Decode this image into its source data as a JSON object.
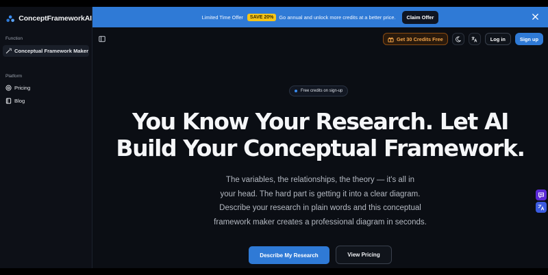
{
  "brand": {
    "name": "ConceptFrameworkAI",
    "logo_icon": "molecule-logo-icon"
  },
  "sidebar": {
    "function_label": "Function",
    "platform_label": "Platform",
    "function_items": [
      {
        "label": "Conceptual Framework Maker",
        "icon": "magic-wand-icon",
        "active": true
      }
    ],
    "platform_items": [
      {
        "label": "Pricing",
        "icon": "coin-icon"
      },
      {
        "label": "Blog",
        "icon": "book-icon"
      }
    ]
  },
  "banner": {
    "text_before": "Limited Time Offer",
    "badge": "SAVE 20%",
    "text_after": "Go annual and unlock more credits at a better price.",
    "cta": "Claim Offer",
    "background": "#2f7ad6",
    "badge_color": "#f5c518"
  },
  "topbar": {
    "credits_button": "Get 30 Credits Free",
    "login": "Log in",
    "signup": "Sign up",
    "icons": [
      "sidebar-toggle-icon",
      "moon-icon",
      "translate-icon"
    ]
  },
  "hero": {
    "pill": "Free credits on sign-up",
    "title_line1": "You Know Your Research. Let AI",
    "title_line2": "Build Your Conceptual Framework.",
    "desc_lines": [
      "The variables, the relationships, the theory — it's all in",
      "your head. The hard part is getting it into a clear diagram.",
      "Describe your research in plain words and this conceptual",
      "framework maker creates a professional diagram in seconds."
    ],
    "primary_cta": "Describe My Research",
    "secondary_cta": "View Pricing"
  },
  "colors": {
    "accent": "#2f7ad6",
    "background": "#0b0e14",
    "credits_orange": "#f3a54a"
  }
}
